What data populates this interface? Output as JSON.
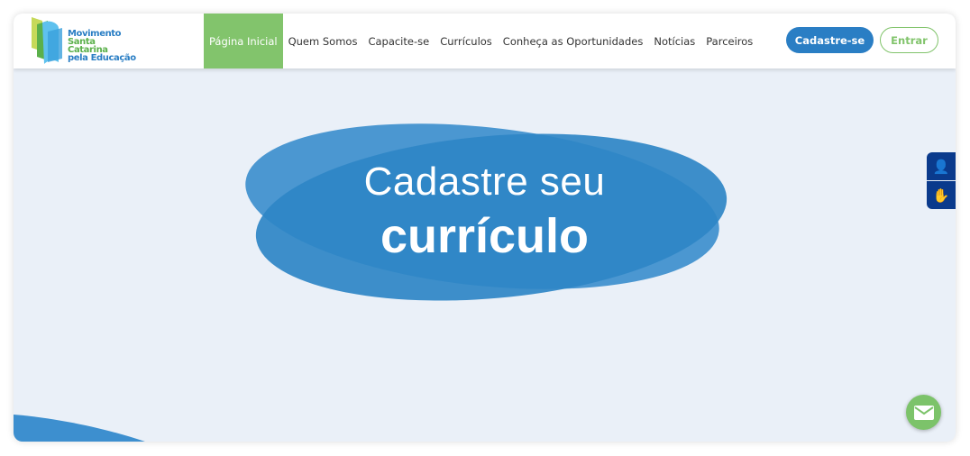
{
  "logo": {
    "line1": "Movimento",
    "line2": "Santa Catarina",
    "line3": "pela Educação"
  },
  "nav": [
    "Página Inicial",
    "Quem Somos",
    "Capacite-se",
    "Currículos",
    "Conheça as Oportunidades",
    "Notícias",
    "Parceiros"
  ],
  "buttons": {
    "signup": "Cadastre-se",
    "login": "Entrar"
  },
  "hero": {
    "line1": "Cadastre seu",
    "line2": "currículo"
  },
  "colors": {
    "primary": "#2a7ec4",
    "accent": "#82c46c",
    "accessibility": "#0a3a8c"
  }
}
